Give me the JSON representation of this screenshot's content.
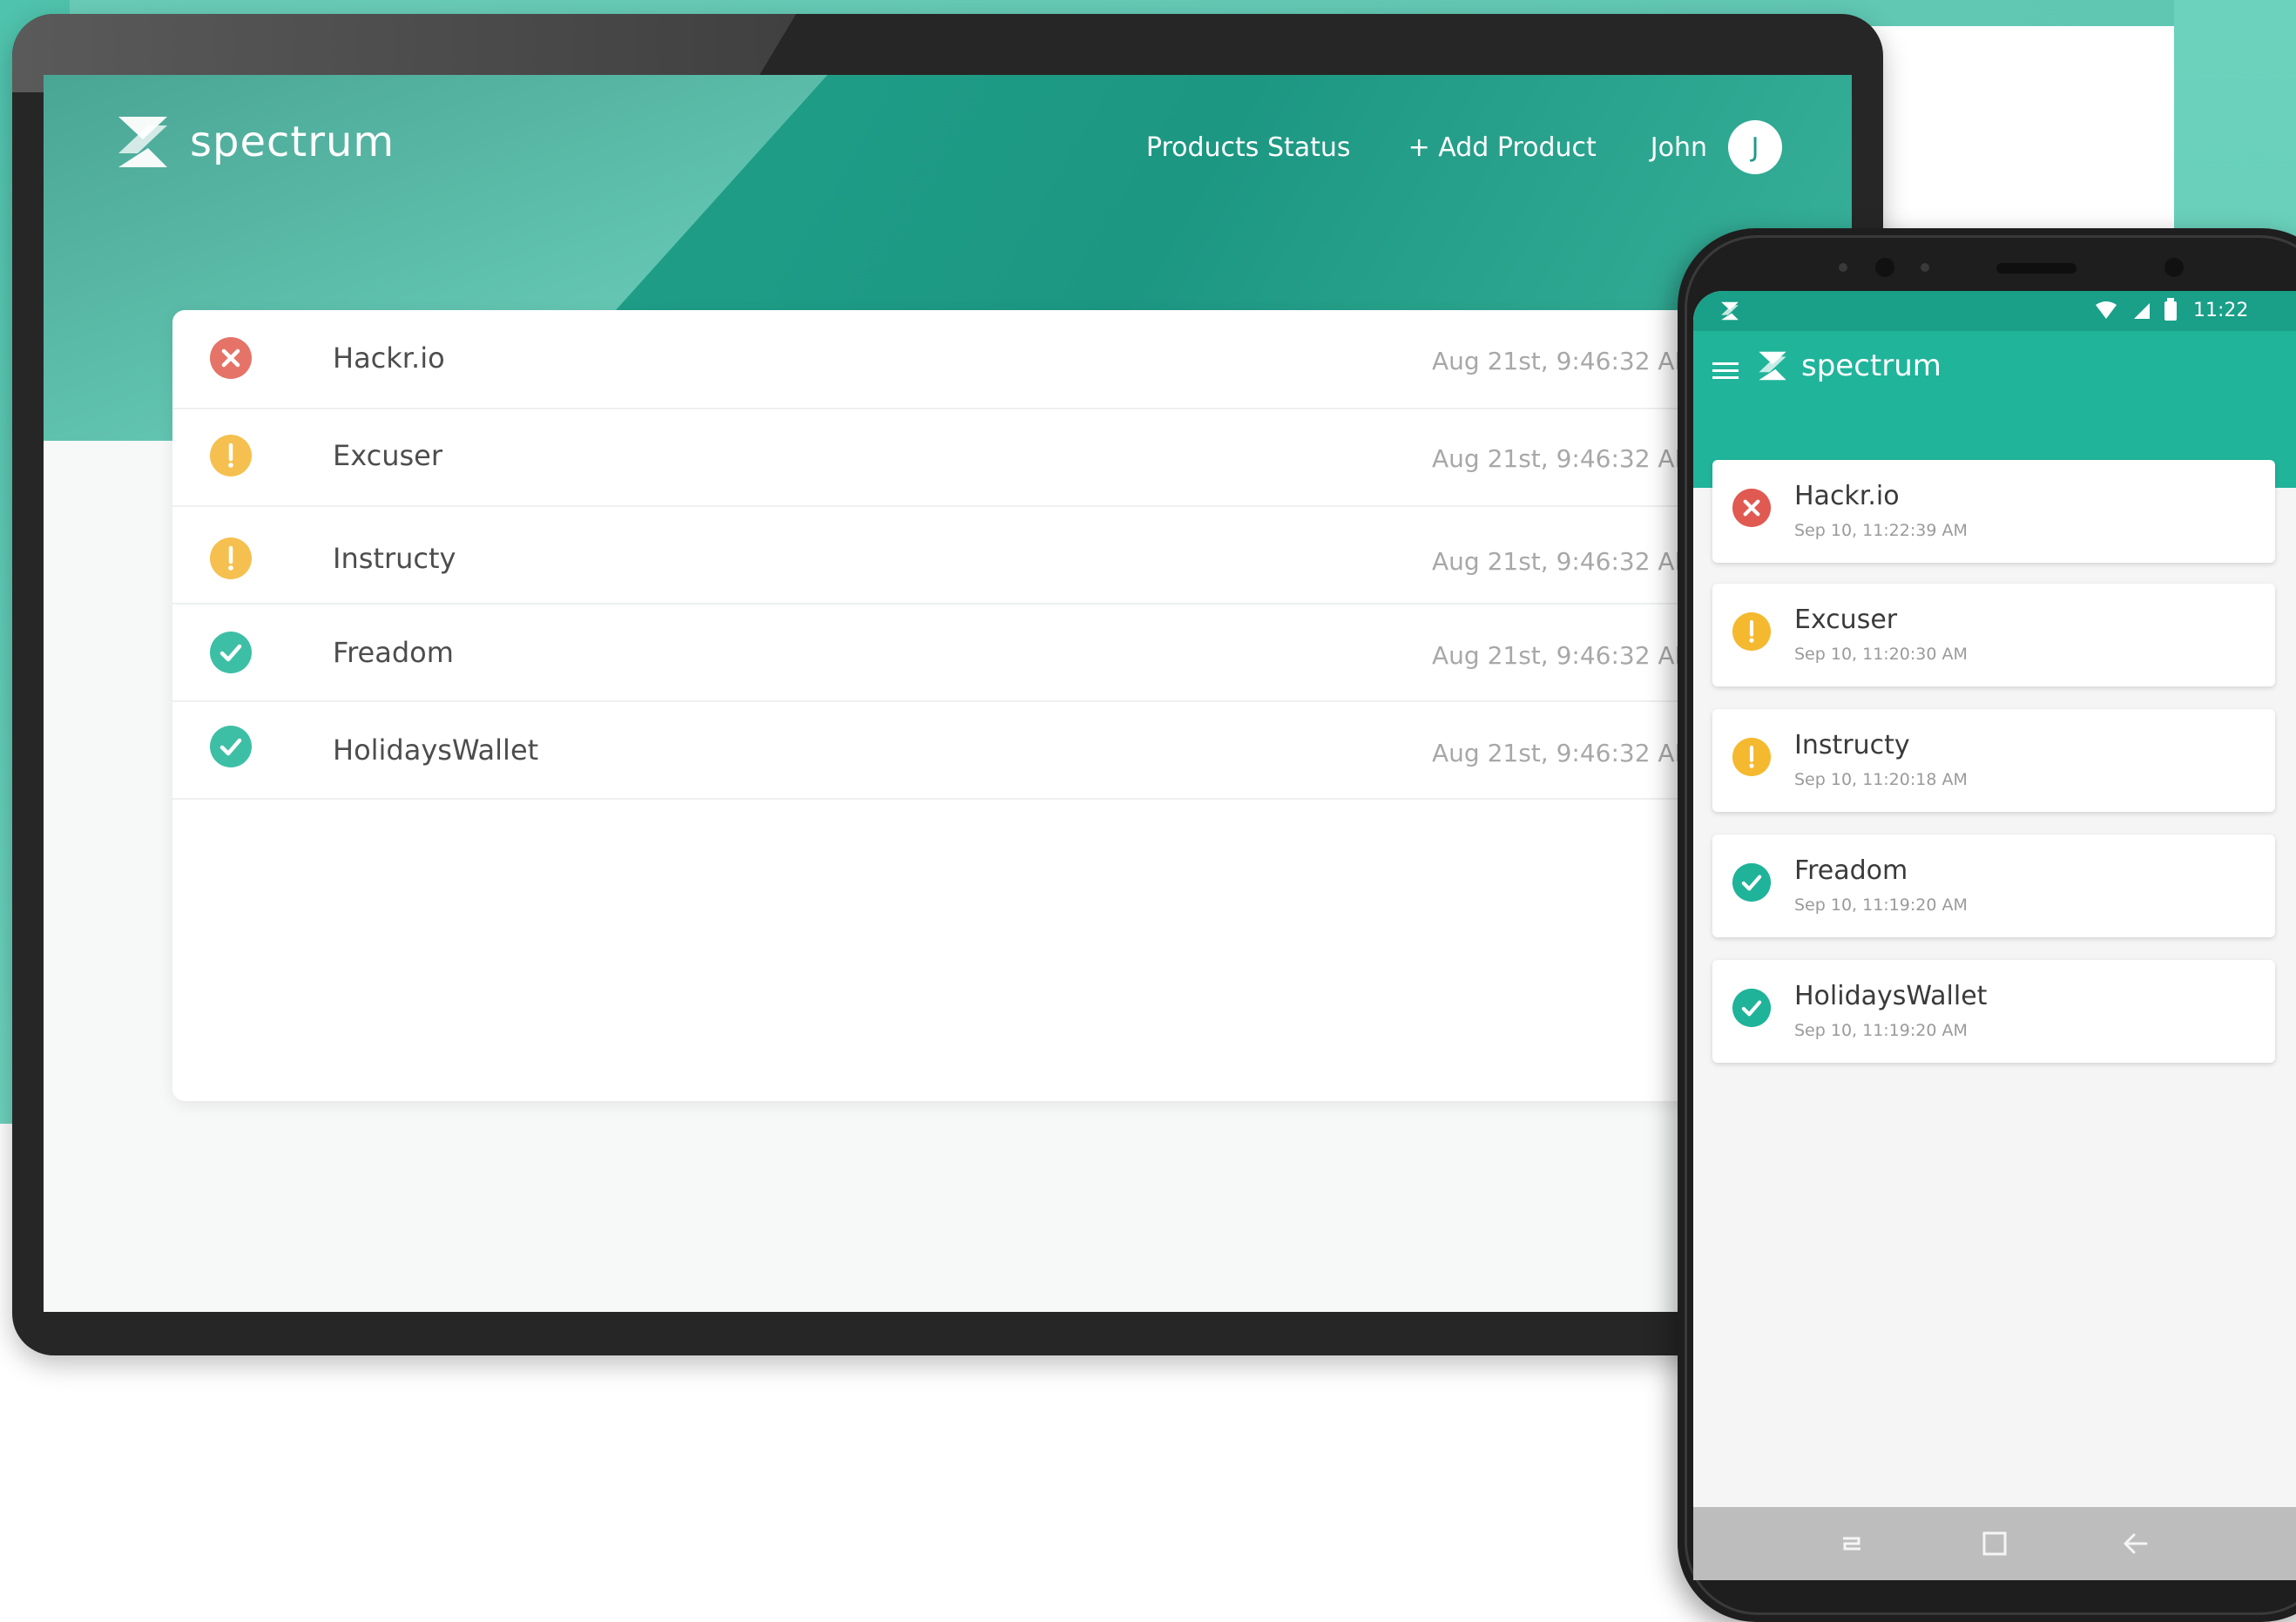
{
  "colors": {
    "brand": "#1f9c86",
    "error": "#e57368",
    "warning": "#f5c04f",
    "ok": "#3dbfa6"
  },
  "desktop": {
    "brand_name": "spectrum",
    "nav": {
      "products_status": "Products Status",
      "add_product": "+ Add Product",
      "user_name": "John",
      "avatar_initial": "J"
    },
    "products": [
      {
        "name": "Hackr.io",
        "status": "error",
        "status_icon": "error-x-icon",
        "time": "Aug 21st, 9:46:32 AM"
      },
      {
        "name": "Excuser",
        "status": "warning",
        "status_icon": "warning-exclamation-icon",
        "time": "Aug 21st, 9:46:32 AM"
      },
      {
        "name": "Instructy",
        "status": "warning",
        "status_icon": "warning-exclamation-icon",
        "time": "Aug 21st, 9:46:32 AM"
      },
      {
        "name": "Freadom",
        "status": "ok",
        "status_icon": "checkmark-icon",
        "time": "Aug 21st, 9:46:32 AM"
      },
      {
        "name": "HolidaysWallet",
        "status": "ok",
        "status_icon": "checkmark-icon",
        "time": "Aug 21st, 9:46:32 AM"
      }
    ]
  },
  "mobile": {
    "status_bar": {
      "time": "11:22"
    },
    "brand_name": "spectrum",
    "products": [
      {
        "name": "Hackr.io",
        "status": "error",
        "time": "Sep 10, 11:22:39 AM"
      },
      {
        "name": "Excuser",
        "status": "warning",
        "time": "Sep 10, 11:20:30 AM"
      },
      {
        "name": "Instructy",
        "status": "warning",
        "time": "Sep 10, 11:20:18 AM"
      },
      {
        "name": "Freadom",
        "status": "ok",
        "time": "Sep 10, 11:19:20 AM"
      },
      {
        "name": "HolidaysWallet",
        "status": "ok",
        "time": "Sep 10, 11:19:20 AM"
      }
    ]
  }
}
